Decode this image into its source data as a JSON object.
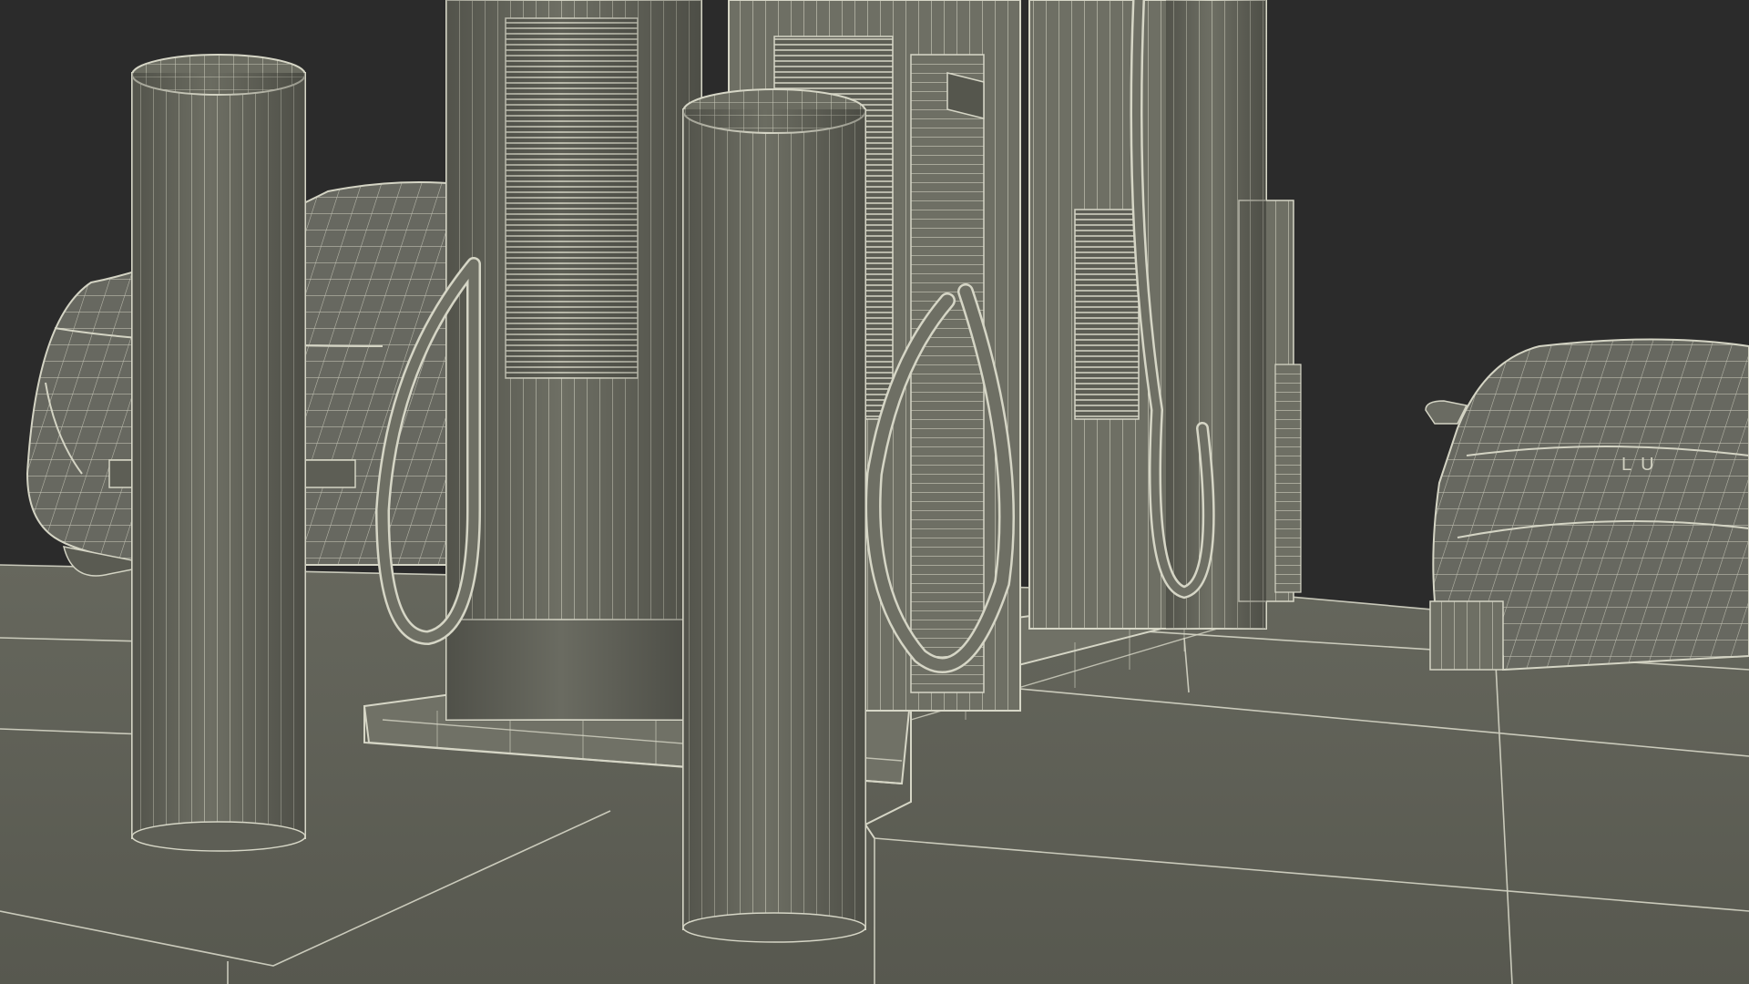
{
  "scene": {
    "background_color": "#2b2b2b",
    "floor_color": "#5f6056",
    "model_color": "#6e6f64",
    "wire_color": "#d8d8c8",
    "car_rear_lettering": "LU",
    "objects": [
      "ev-charging-station",
      "charger-pedestal-left",
      "charger-pedestal-center",
      "charger-pedestal-right",
      "charging-cable",
      "bollard",
      "car",
      "curb",
      "floor-grid"
    ]
  }
}
